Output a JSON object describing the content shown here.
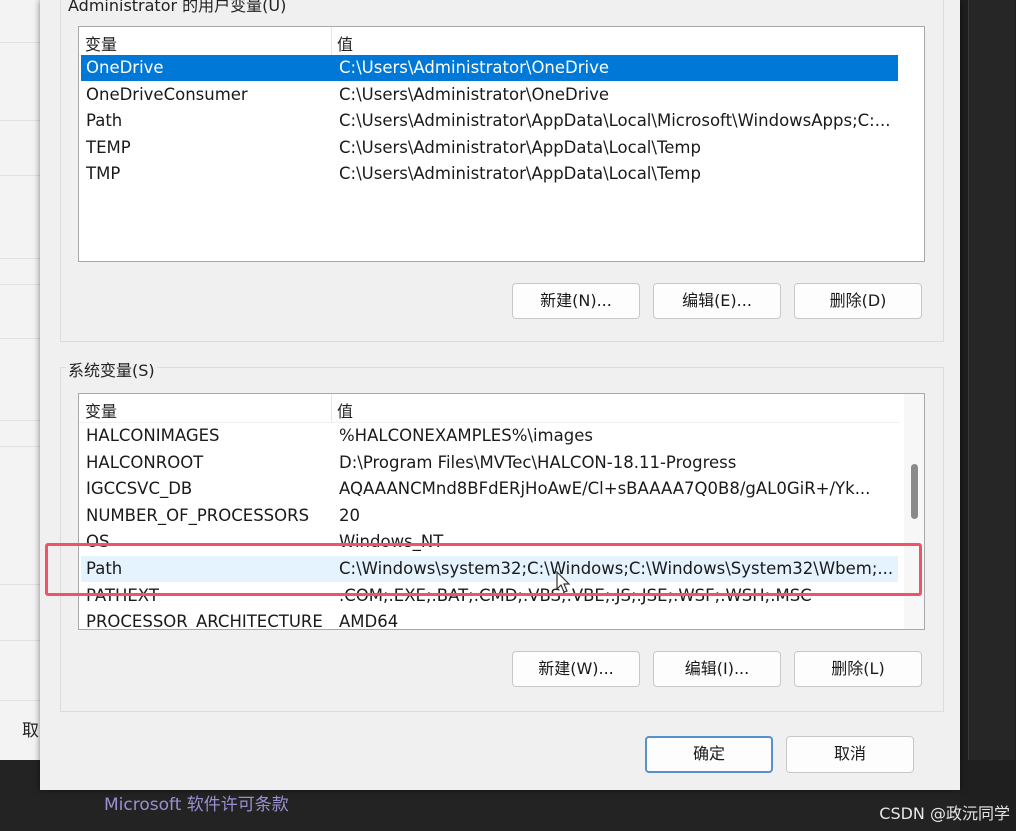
{
  "background": {
    "left_label": "取",
    "bottom_text": "Microsoft 软件许可条款",
    "watermark": "CSDN @政沅同学"
  },
  "user_vars": {
    "title": "Administrator 的用户变量(U)",
    "col_name": "变量",
    "col_value": "值",
    "rows": [
      {
        "name": "OneDrive",
        "value": "C:\\Users\\Administrator\\OneDrive"
      },
      {
        "name": "OneDriveConsumer",
        "value": "C:\\Users\\Administrator\\OneDrive"
      },
      {
        "name": "Path",
        "value": "C:\\Users\\Administrator\\AppData\\Local\\Microsoft\\WindowsApps;C:..."
      },
      {
        "name": "TEMP",
        "value": "C:\\Users\\Administrator\\AppData\\Local\\Temp"
      },
      {
        "name": "TMP",
        "value": "C:\\Users\\Administrator\\AppData\\Local\\Temp"
      }
    ],
    "selected_index": 0,
    "buttons": {
      "new": "新建(N)...",
      "edit": "编辑(E)...",
      "delete": "删除(D)"
    }
  },
  "system_vars": {
    "title": "系统变量(S)",
    "col_name": "变量",
    "col_value": "值",
    "rows": [
      {
        "name": "HALCONIMAGES",
        "value": "%HALCONEXAMPLES%\\images"
      },
      {
        "name": "HALCONROOT",
        "value": "D:\\Program Files\\MVTec\\HALCON-18.11-Progress"
      },
      {
        "name": "IGCCSVC_DB",
        "value": "AQAAANCMnd8BFdERjHoAwE/Cl+sBAAAA7Q0B8/gAL0GiR+/Yk..."
      },
      {
        "name": "NUMBER_OF_PROCESSORS",
        "value": "20"
      },
      {
        "name": "OS",
        "value": "Windows_NT"
      },
      {
        "name": "Path",
        "value": "C:\\Windows\\system32;C:\\Windows;C:\\Windows\\System32\\Wbem;..."
      },
      {
        "name": "PATHEXT",
        "value": ".COM;.EXE;.BAT;.CMD;.VBS;.VBE;.JS;.JSE;.WSF;.WSH;.MSC"
      },
      {
        "name": "PROCESSOR_ARCHITECTURE",
        "value": "AMD64"
      }
    ],
    "hover_index": 5,
    "buttons": {
      "new": "新建(W)...",
      "edit": "编辑(I)...",
      "delete": "删除(L)"
    }
  },
  "footer": {
    "ok": "确定",
    "cancel": "取消"
  },
  "colors": {
    "selection": "#0078d7",
    "highlight_box": "#f0526a"
  }
}
